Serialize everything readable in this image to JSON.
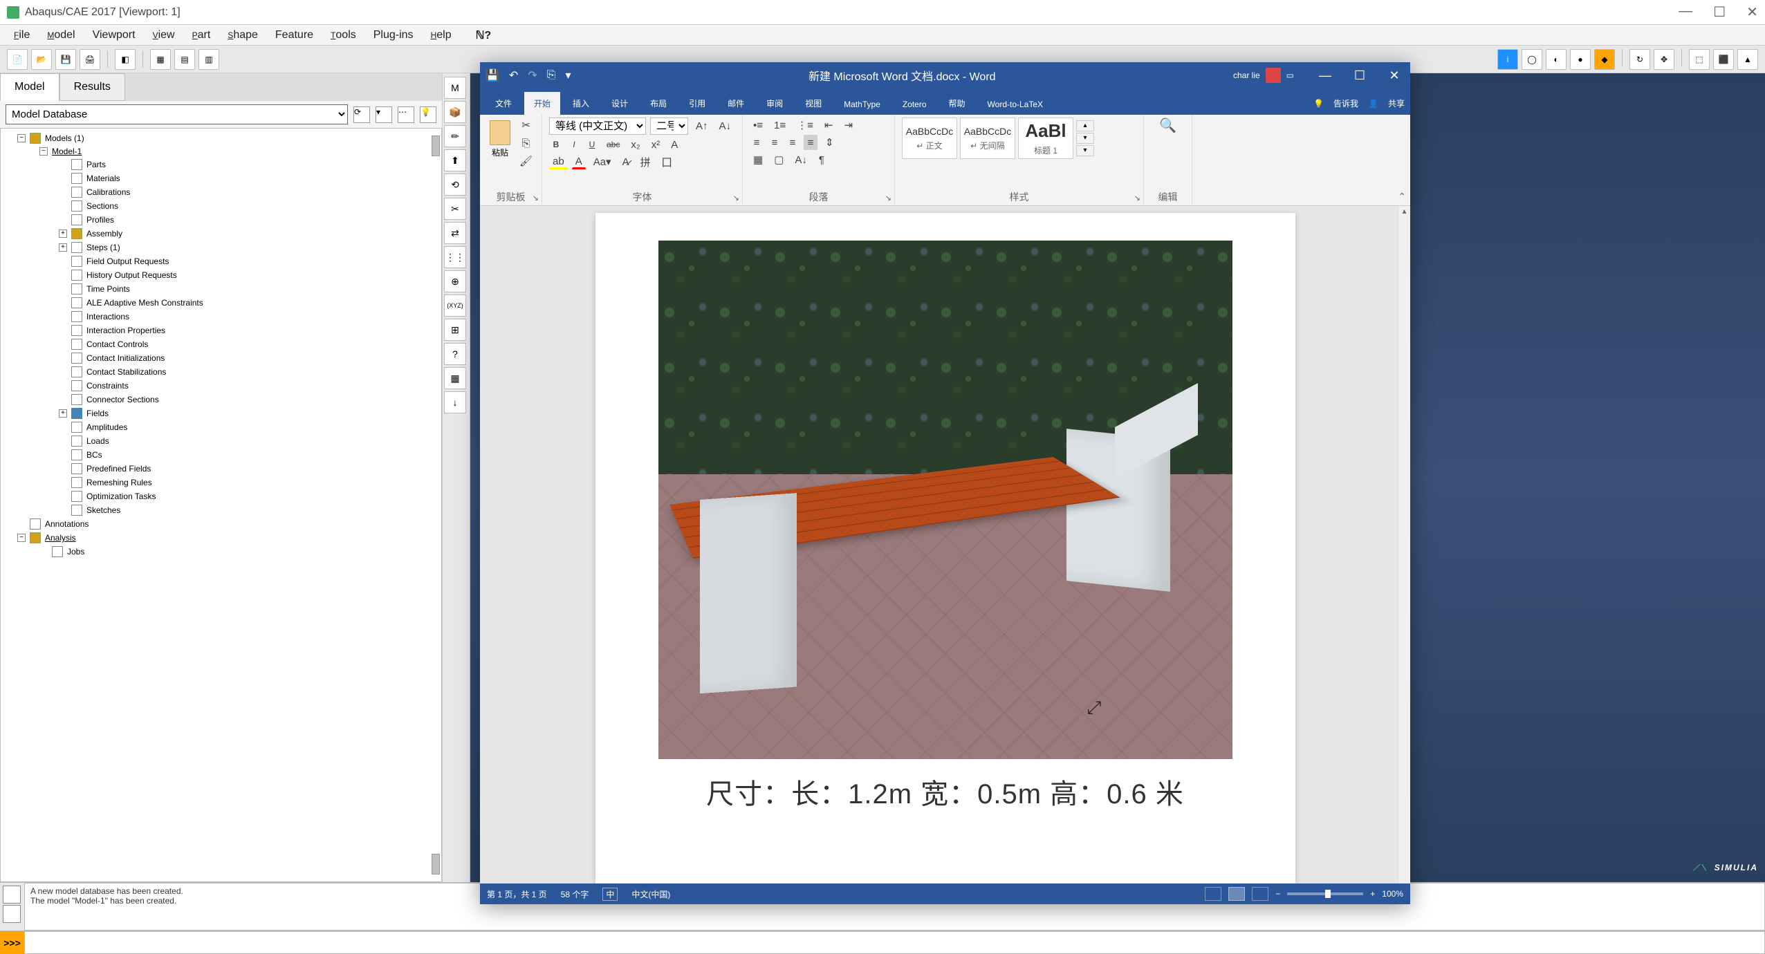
{
  "abaqus": {
    "title": "Abaqus/CAE 2017 [Viewport: 1]",
    "menus": [
      "File",
      "Model",
      "Viewport",
      "View",
      "Part",
      "Shape",
      "Feature",
      "Tools",
      "Plug-ins",
      "Help"
    ],
    "tabs": {
      "model": "Model",
      "results": "Results"
    },
    "model_db": "Model Database",
    "tree": {
      "models_root": "Models (1)",
      "model1": "Model-1",
      "items": [
        "Parts",
        "Materials",
        "Calibrations",
        "Sections",
        "Profiles",
        "Assembly",
        "Steps (1)",
        "Field Output Requests",
        "History Output Requests",
        "Time Points",
        "ALE Adaptive Mesh Constraints",
        "Interactions",
        "Interaction Properties",
        "Contact Controls",
        "Contact Initializations",
        "Contact Stabilizations",
        "Constraints",
        "Connector Sections",
        "Fields",
        "Amplitudes",
        "Loads",
        "BCs",
        "Predefined Fields",
        "Remeshing Rules",
        "Optimization Tasks",
        "Sketches"
      ],
      "annotations": "Annotations",
      "analysis": "Analysis",
      "jobs": "Jobs"
    },
    "messages": {
      "line1": "A new model database has been created.",
      "line2": "The model \"Model-1\" has been created."
    },
    "simulia": "SIMULIA"
  },
  "word": {
    "qat_icons": [
      "save-icon",
      "undo-icon",
      "redo-icon",
      "copy-icon",
      "customize-icon"
    ],
    "doc_title": "新建 Microsoft Word 文档.docx - Word",
    "user": "char lie",
    "ribbon_tabs": [
      "文件",
      "开始",
      "插入",
      "设计",
      "布局",
      "引用",
      "邮件",
      "审阅",
      "视图",
      "MathType",
      "Zotero",
      "帮助",
      "Word-to-LaTeX"
    ],
    "active_tab": "开始",
    "tell_me": "告诉我",
    "share": "共享",
    "groups": {
      "clipboard": {
        "paste": "粘贴",
        "label": "剪贴板"
      },
      "font": {
        "font_name": "等线 (中文正文)",
        "font_size": "二号",
        "label": "字体"
      },
      "paragraph": {
        "label": "段落"
      },
      "styles": {
        "label": "样式",
        "s1_prev": "AaBbCcDc",
        "s1_name": "↵ 正文",
        "s2_prev": "AaBbCcDc",
        "s2_name": "↵ 无间隔",
        "s3_prev": "AaBl",
        "s3_name": "标题 1"
      },
      "editing": {
        "label": "编辑"
      }
    },
    "document": {
      "image_alt": "park-bench-photo",
      "dimensions": "尺寸：长：1.2m 宽：0.5m 高：0.6 米"
    },
    "status": {
      "page": "第 1 页，共 1 页",
      "words": "58 个字",
      "lang_icon": "中",
      "lang": "中文(中国)",
      "zoom": "100%",
      "zoom_minus": "−",
      "zoom_plus": "+"
    }
  }
}
